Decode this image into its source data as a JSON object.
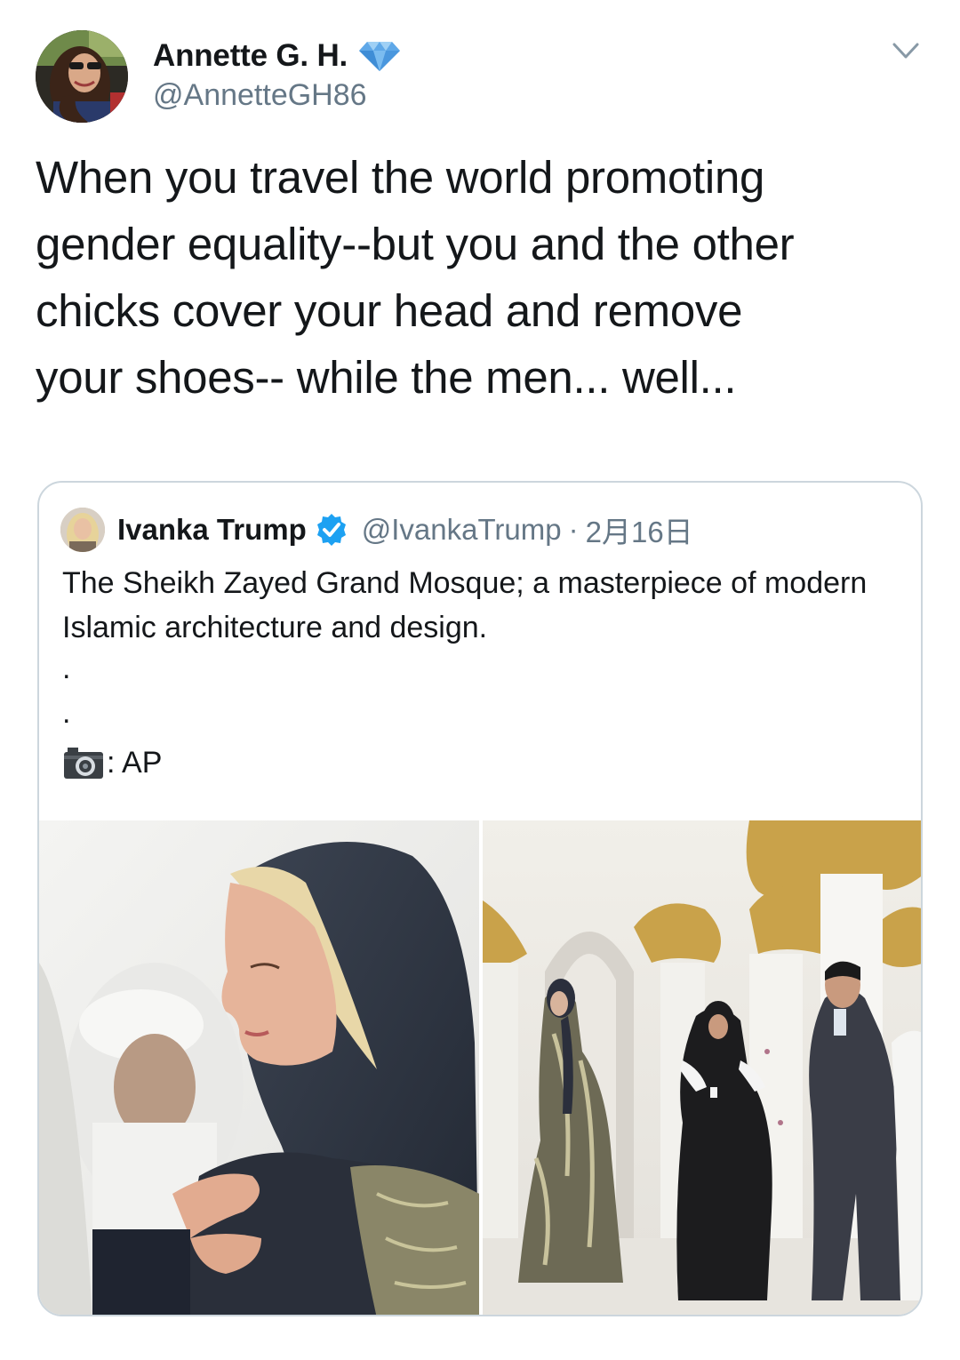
{
  "author": {
    "display_name": "Annette G. H.",
    "handle": "@AnnetteGH86",
    "badge_icon": "diamond-icon",
    "badge_color": "#5fa8e8"
  },
  "tweet": {
    "text": "When you travel the world promoting\ngender equality--but you and the other\nchicks cover your head and remove\nyour shoes-- while the men... well..."
  },
  "menu": {
    "icon": "chevron-down-icon"
  },
  "quoted_tweet": {
    "display_name": "Ivanka Trump",
    "verified_icon": "verified-icon",
    "verified_color": "#1da1f2",
    "handle": "@IvankaTrump",
    "separator": "·",
    "date": "2月16日",
    "text": "The Sheikh Zayed Grand Mosque; a masterpiece of modern Islamic architecture and design.",
    "dot_line_1": ".",
    "dot_line_2": ".",
    "credit_icon": "camera-icon",
    "credit_text": ": AP",
    "media": [
      {
        "icon": "photo-portrait"
      },
      {
        "icon": "photo-mosque-walkway"
      }
    ]
  },
  "colors": {
    "primary_text": "#14171a",
    "secondary_text": "#657786",
    "card_border": "#ccd6dd"
  }
}
